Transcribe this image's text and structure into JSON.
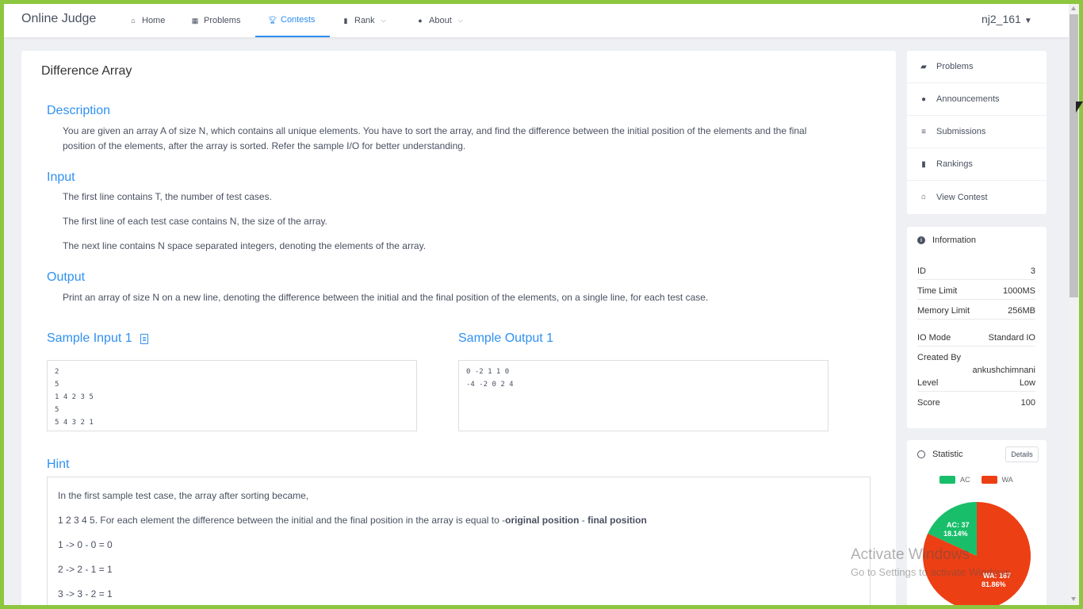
{
  "app": {
    "brand": "Online Judge",
    "user": "nj2_161"
  },
  "nav": {
    "home": "Home",
    "problems": "Problems",
    "contests": "Contests",
    "rank": "Rank",
    "about": "About"
  },
  "problem": {
    "title": "Difference Array",
    "description_h": "Description",
    "description_1": "You are given an array A of size N, which contains all unique elements. You have to sort the array, and find the difference between the initial position of the elements and the final",
    "description_2": "position of the elements, after the array is sorted. Refer the sample I/O for better understanding.",
    "input_h": "Input",
    "input_1": "The first line contains T, the number of test cases.",
    "input_2": "The first line of each test case contains N, the size of the array.",
    "input_3": "The next line contains N space separated integers, denoting the elements of the array.",
    "output_h": "Output",
    "output_1": "Print an array of size N on a new line, denoting the difference between the initial and the final position of the elements, on a single line, for each test case.",
    "sample_input_h": "Sample Input 1",
    "sample_output_h": "Sample Output 1",
    "sample_input": "2\n5\n1 4 2 3 5\n5\n5 4 3 2 1",
    "sample_output": "0 -2 1 1 0\n-4 -2 0 2 4",
    "hint_h": "Hint",
    "hint_1": "In the first sample test case, the array after sorting became,",
    "hint_2a": "1 2 3 4 5. For each element the difference between the initial and the final position in the array is equal to -",
    "hint_2b": "original position",
    "hint_2c": " - ",
    "hint_2d": "final position",
    "hint_3": "1 -> 0 - 0 = 0",
    "hint_4": "2 -> 2 - 1 = 1",
    "hint_5": "3 -> 3 - 2 = 1"
  },
  "sidebar": {
    "problems": "Problems",
    "announcements": "Announcements",
    "submissions": "Submissions",
    "rankings": "Rankings",
    "view_contest": "View Contest"
  },
  "info": {
    "header": "Information",
    "id_label": "ID",
    "id_value": "3",
    "time_label": "Time Limit",
    "time_value": "1000MS",
    "memory_label": "Memory Limit",
    "memory_value": "256MB",
    "io_label": "IO Mode",
    "io_value": "Standard IO",
    "created_label": "Created By",
    "created_value": "ankushchimnani",
    "level_label": "Level",
    "level_value": "Low",
    "score_label": "Score",
    "score_value": "100"
  },
  "statistic": {
    "header": "Statistic",
    "details": "Details",
    "legend_ac": "AC",
    "legend_wa": "WA",
    "ac_label": "AC: 37",
    "ac_pct": "18.14%",
    "wa_label": "WA: 167",
    "wa_pct": "81.86%",
    "ac_value": 37,
    "wa_value": 167,
    "ac_color": "#19be6b",
    "wa_color": "#ed3f14"
  },
  "watermark": {
    "line1": "Activate Windows",
    "line2": "Go to Settings to activate Windows."
  }
}
